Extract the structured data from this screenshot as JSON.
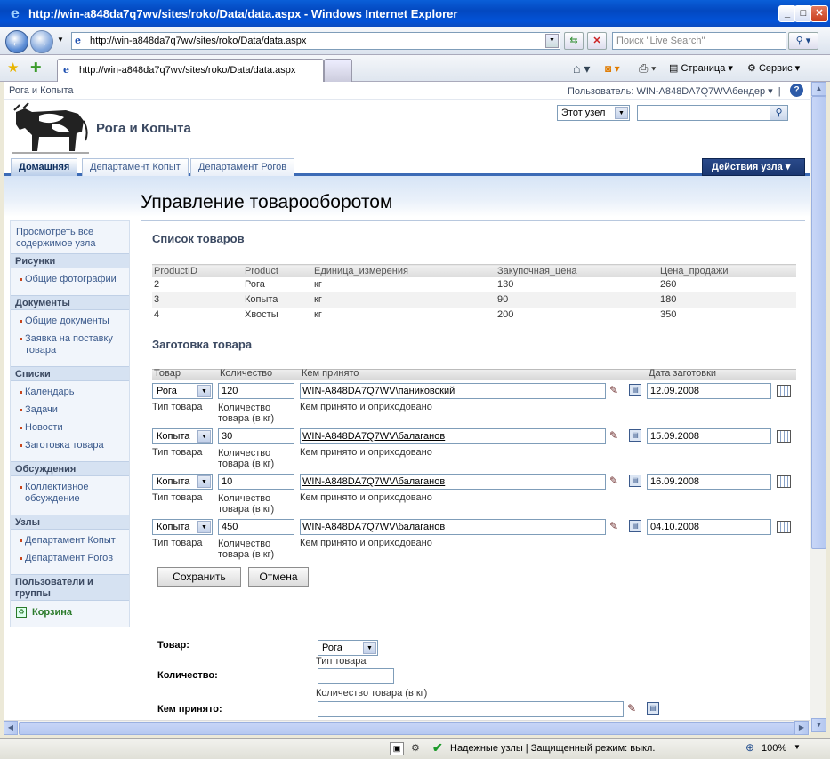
{
  "window": {
    "title": "http://win-a848da7q7wv/sites/roko/Data/data.aspx - Windows Internet Explorer",
    "address": "http://win-a848da7q7wv/sites/roko/Data/data.aspx",
    "search_placeholder": "Поиск \"Live Search\"",
    "tab_title": "http://win-a848da7q7wv/sites/roko/Data/data.aspx",
    "page_menu": "Страница",
    "tools_menu": "Сервис"
  },
  "sp": {
    "breadcrumb": "Рога и Копыта",
    "user": "Пользователь: WIN-A848DA7Q7WV\\бендер",
    "site_title": "Рога и Копыта",
    "scope": "Этот узел",
    "tabs": [
      "Домашняя",
      "Департамент Копыт",
      "Департамент Рогов"
    ],
    "site_actions": "Действия узла",
    "page_title": "Управление товарооборотом"
  },
  "leftnav": {
    "view_all": "Просмотреть все содержимое узла",
    "pictures": "Рисунки",
    "pictures_items": [
      "Общие фотографии"
    ],
    "documents": "Документы",
    "documents_items": [
      "Общие документы",
      "Заявка на поставку товара"
    ],
    "lists": "Списки",
    "lists_items": [
      "Календарь",
      "Задачи",
      "Новости",
      "Заготовка товара"
    ],
    "discussions": "Обсуждения",
    "discussions_items": [
      "Коллективное обсуждение"
    ],
    "sites": "Узлы",
    "sites_items": [
      "Департамент Копыт",
      "Департамент Рогов"
    ],
    "people": "Пользователи и группы",
    "recycle": "Корзина"
  },
  "products": {
    "heading": "Список товаров",
    "columns": [
      "ProductID",
      "Product",
      "Единица_измерения",
      "Закупочная_цена",
      "Цена_продажи"
    ],
    "rows": [
      [
        "2",
        "Рога",
        "кг",
        "130",
        "260"
      ],
      [
        "3",
        "Копыта",
        "кг",
        "90",
        "180"
      ],
      [
        "4",
        "Хвосты",
        "кг",
        "200",
        "350"
      ]
    ]
  },
  "procurement": {
    "heading": "Заготовка товара",
    "columns": [
      "Товар",
      "Количество",
      "Кем принято",
      "Дата заготовки"
    ],
    "hint_product": "Тип товара",
    "hint_qty": "Количество товара (в кг)",
    "hint_who": "Кем принято и оприходовано",
    "rows": [
      {
        "product": "Рога",
        "qty": "120",
        "who": "WIN-A848DA7Q7WV\\паниковский",
        "date": "12.09.2008"
      },
      {
        "product": "Копыта",
        "qty": "30",
        "who": "WIN-A848DA7Q7WV\\балаганов",
        "date": "15.09.2008"
      },
      {
        "product": "Копыта",
        "qty": "10",
        "who": "WIN-A848DA7Q7WV\\балаганов",
        "date": "16.09.2008"
      },
      {
        "product": "Копыта",
        "qty": "450",
        "who": "WIN-A848DA7Q7WV\\балаганов",
        "date": "04.10.2008"
      }
    ],
    "save": "Сохранить",
    "cancel": "Отмена"
  },
  "form": {
    "product_label": "Товар:",
    "product_value": "Рога",
    "product_hint": "Тип товара",
    "qty_label": "Количество:",
    "qty_value": "",
    "qty_hint": "Количество товара (в кг)",
    "who_label": "Кем принято:",
    "who_value": ""
  },
  "status": {
    "zone": "Надежные узлы | Защищенный режим: выкл.",
    "zoom": "100%"
  }
}
